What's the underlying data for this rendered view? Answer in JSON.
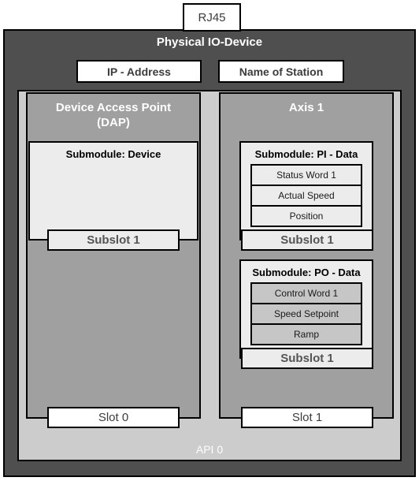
{
  "diagram": {
    "connector": {
      "label": "RJ45"
    },
    "device": {
      "title": "Physical IO-Device",
      "identity": [
        {
          "name": "ip-address",
          "label": "IP - Address"
        },
        {
          "name": "name-of-station",
          "label": "Name of Station"
        }
      ],
      "api": {
        "label": "API 0",
        "slots": [
          {
            "slot_label": "Slot 0",
            "title": "Device Access Point (DAP)",
            "title_line1": "Device Access Point",
            "title_line2": "(DAP)",
            "submodules": [
              {
                "title": "Submodule: Device",
                "subslot_label": "Subslot 1",
                "rows": []
              }
            ]
          },
          {
            "slot_label": "Slot 1",
            "title": "Axis 1",
            "title_line1": "Axis 1",
            "title_line2": "",
            "submodules": [
              {
                "title": "Submodule: PI - Data",
                "subslot_label": "Subslot 1",
                "rows": [
                  "Status Word 1",
                  "Actual Speed",
                  "Position"
                ]
              },
              {
                "title": "Submodule: PO - Data",
                "subslot_label": "Subslot 1",
                "rows": [
                  "Control Word 1",
                  "Speed Setpoint",
                  "Ramp"
                ]
              }
            ]
          }
        ]
      }
    }
  },
  "colors": {
    "device_body": "#4f4f4f",
    "api_body": "#cccccc",
    "slot_body": "#a0a0a0",
    "submodule_body": "#ececec",
    "row_shaded": "#c6c6c6",
    "box_white": "#ffffff",
    "outline": "#000000"
  }
}
